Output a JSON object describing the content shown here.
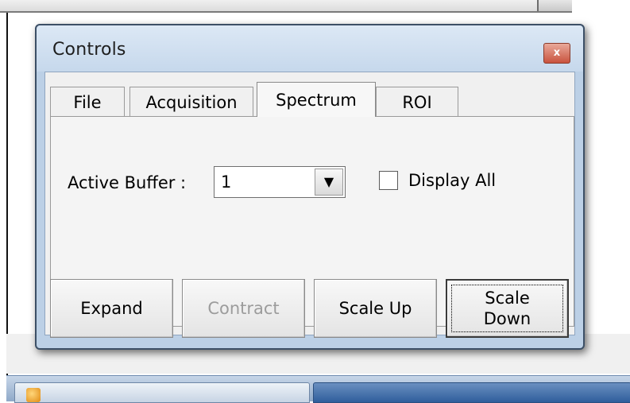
{
  "window": {
    "title": "Controls",
    "close_glyph": "x"
  },
  "tabs": [
    {
      "label": "File",
      "active": false
    },
    {
      "label": "Acquisition",
      "active": false
    },
    {
      "label": "Spectrum",
      "active": true
    },
    {
      "label": "ROI",
      "active": false
    }
  ],
  "spectrum": {
    "active_buffer_label": "Active Buffer :",
    "active_buffer_value": "1",
    "dropdown_arrow": "▼",
    "display_all_label": "Display All",
    "display_all_checked": false
  },
  "buttons": {
    "expand": "Expand",
    "contract": "Contract",
    "contract_enabled": false,
    "scale_up": "Scale Up",
    "scale_down_line1": "Scale",
    "scale_down_line2": "Down"
  },
  "colors": {
    "window_frame": "#bcd0e6",
    "close_button": "#c9533e",
    "disabled_text": "#9c9c9c"
  },
  "icons": {
    "close": "close-icon",
    "dropdown": "chevron-down-icon"
  }
}
